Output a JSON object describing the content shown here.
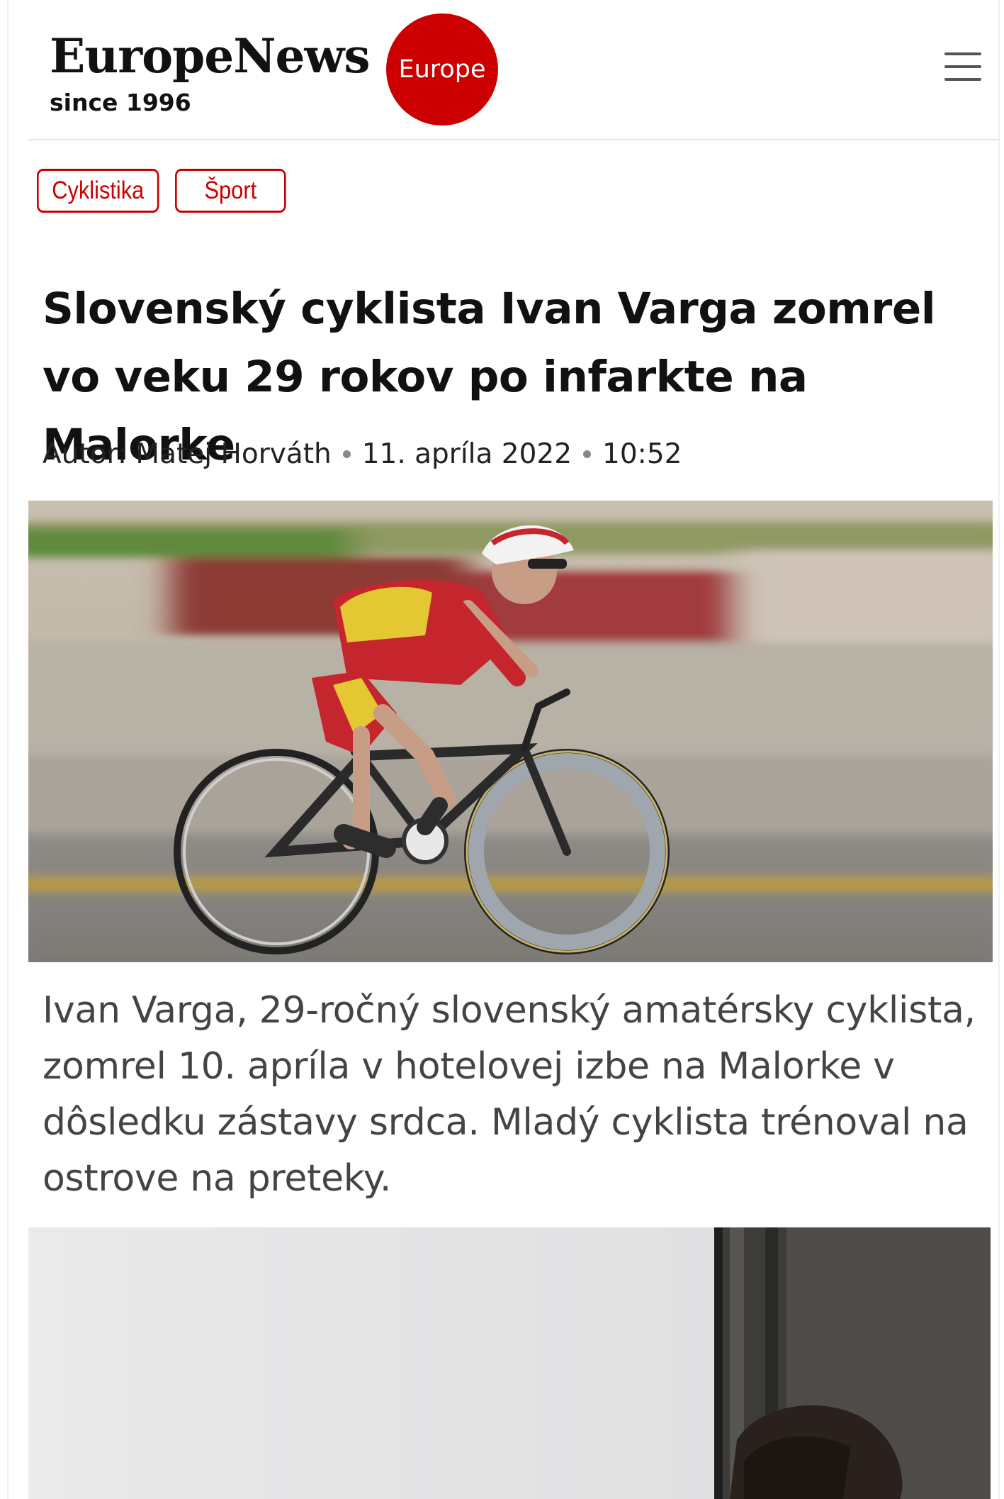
{
  "header": {
    "brand": "EuropeNews",
    "tagline": "since 1996",
    "region_badge": "Europe",
    "menu_icon": "hamburger-menu-icon"
  },
  "tags": [
    "Cyklistika",
    "Šport"
  ],
  "article": {
    "title": "Slovenský cyklista Ivan Varga zomrel vo veku 29 rokov po infarkte na Malorke",
    "author": "Autor: Matej Horváth",
    "date": "11. apríla 2022",
    "time": "10:52",
    "lead": "Ivan Varga, 29-ročný slovenský amatérsky cyklista, zomrel 10. apríla v hotelovej izbe na Malorke v dôsledku zástavy srdca. Mladý cyklista trénoval na ostrove na preteky."
  },
  "colors": {
    "accent": "#cc0000",
    "text": "#111111",
    "lead_text": "#444444"
  }
}
